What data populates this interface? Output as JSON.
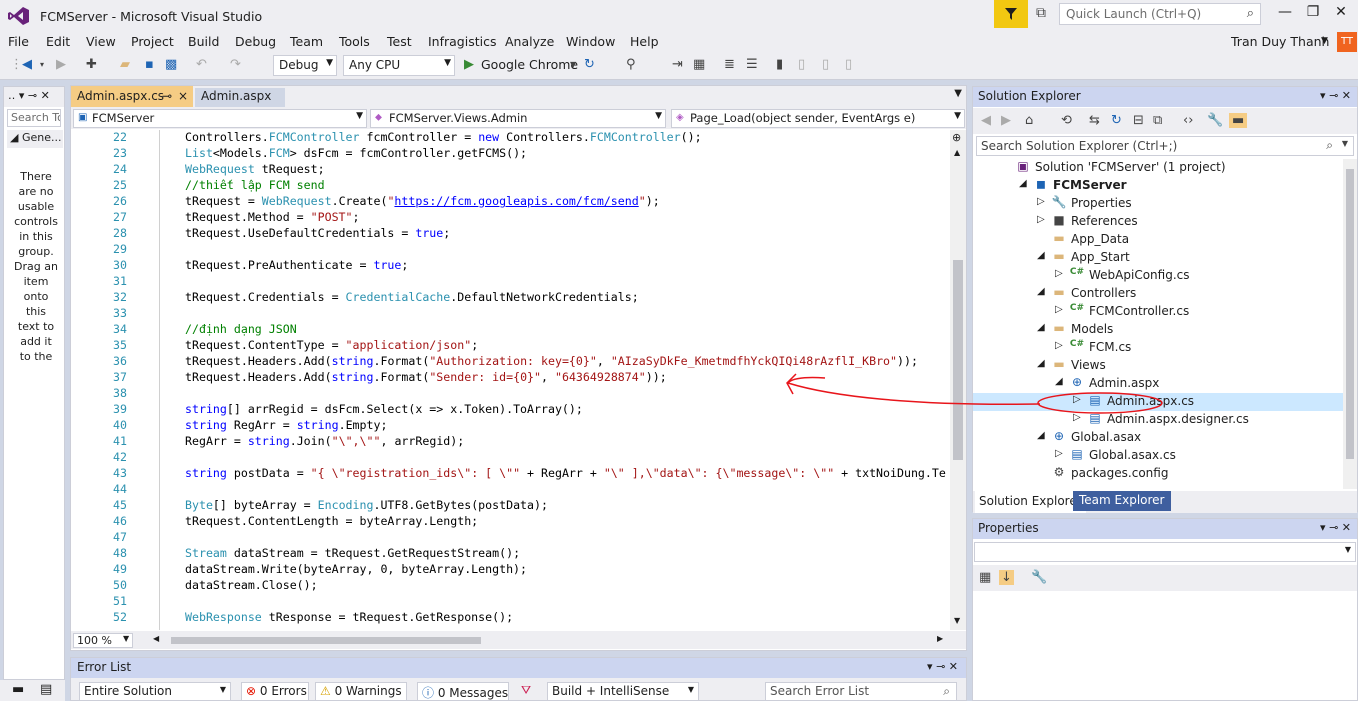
{
  "window": {
    "title": "FCMServer - Microsoft Visual Studio",
    "quick_launch": "Quick Launch (Ctrl+Q)",
    "user": "Tran Duy Thanh",
    "initials": "TT"
  },
  "menu": [
    "File",
    "Edit",
    "View",
    "Project",
    "Build",
    "Debug",
    "Team",
    "Tools",
    "Test",
    "Infragistics",
    "Analyze",
    "Window",
    "Help"
  ],
  "toolbar": {
    "config": "Debug",
    "platform": "Any CPU",
    "browser": "Google Chrome"
  },
  "toolbox": {
    "search": "Search Too",
    "group": "Gene...",
    "message": "There are no usable controls in this group. Drag an item onto this text to add it to the"
  },
  "editor": {
    "tabs": [
      {
        "label": "Admin.aspx.cs",
        "pin": "⊸",
        "close": "×"
      },
      {
        "label": "Admin.aspx"
      }
    ],
    "nav": {
      "project": "FCMServer",
      "class": "FCMServer.Views.Admin",
      "member": "Page_Load(object sender, EventArgs e)"
    },
    "zoom": "100 %",
    "lines": [
      {
        "n": "22",
        "html": "Controllers.<span class=\"t\">FCMController</span> fcmController = <span class=\"k\">new</span> Controllers.<span class=\"t\">FCMController</span>();"
      },
      {
        "n": "23",
        "html": "<span class=\"t\">List</span>&lt;Models.<span class=\"t\">FCM</span>&gt; dsFcm = fcmController.getFCMS();"
      },
      {
        "n": "24",
        "html": "<span class=\"t\">WebRequest</span> tRequest;"
      },
      {
        "n": "25",
        "html": "<span class=\"c\">//thiết lập FCM send</span>"
      },
      {
        "n": "26",
        "html": "tRequest = <span class=\"t\">WebRequest</span>.Create(<span class=\"s\">\"</span><span class=\"u\">https://fcm.googleapis.com/fcm/send</span><span class=\"s\">\"</span>);"
      },
      {
        "n": "27",
        "html": "tRequest.Method = <span class=\"s\">\"POST\"</span>;"
      },
      {
        "n": "28",
        "html": "tRequest.UseDefaultCredentials = <span class=\"k\">true</span>;"
      },
      {
        "n": "29",
        "html": ""
      },
      {
        "n": "30",
        "html": "tRequest.PreAuthenticate = <span class=\"k\">true</span>;"
      },
      {
        "n": "31",
        "html": ""
      },
      {
        "n": "32",
        "html": "tRequest.Credentials = <span class=\"t\">CredentialCache</span>.DefaultNetworkCredentials;"
      },
      {
        "n": "33",
        "html": ""
      },
      {
        "n": "34",
        "html": "<span class=\"c\">//định dạng JSON</span>"
      },
      {
        "n": "35",
        "html": "tRequest.ContentType = <span class=\"s\">\"application/json\"</span>;"
      },
      {
        "n": "36",
        "html": "tRequest.Headers.Add(<span class=\"k\">string</span>.Format(<span class=\"s\">\"Authorization: key={0}\"</span>, <span class=\"s\">\"AIzaSyDkFe_KmetmdfhYckQIQi48rAzflI_KBro\"</span>));"
      },
      {
        "n": "37",
        "html": "tRequest.Headers.Add(<span class=\"k\">string</span>.Format(<span class=\"s\">\"Sender: id={0}\"</span>, <span class=\"s\">\"64364928874\"</span>));"
      },
      {
        "n": "38",
        "html": ""
      },
      {
        "n": "39",
        "html": "<span class=\"k\">string</span>[] arrRegid = dsFcm.Select(x =&gt; x.Token).ToArray();"
      },
      {
        "n": "40",
        "html": "<span class=\"k\">string</span> RegArr = <span class=\"k\">string</span>.Empty;"
      },
      {
        "n": "41",
        "html": "RegArr = <span class=\"k\">string</span>.Join(<span class=\"s\">\"\\\",\\\"\"</span>, arrRegid);"
      },
      {
        "n": "42",
        "html": ""
      },
      {
        "n": "43",
        "html": "<span class=\"k\">string</span> postData = <span class=\"s\">\"{ \\\"registration_ids\\\": [ \\\"\"</span> + RegArr + <span class=\"s\">\"\\\" ],\\\"data\\\": {\\\"message\\\": \\\"\"</span> + txtNoiDung.Te"
      },
      {
        "n": "44",
        "html": ""
      },
      {
        "n": "45",
        "html": "<span class=\"t\">Byte</span>[] byteArray = <span class=\"t\">Encoding</span>.UTF8.GetBytes(postData);"
      },
      {
        "n": "46",
        "html": "tRequest.ContentLength = byteArray.Length;"
      },
      {
        "n": "47",
        "html": ""
      },
      {
        "n": "48",
        "html": "<span class=\"t\">Stream</span> dataStream = tRequest.GetRequestStream();"
      },
      {
        "n": "49",
        "html": "dataStream.Write(byteArray, 0, byteArray.Length);"
      },
      {
        "n": "50",
        "html": "dataStream.Close();"
      },
      {
        "n": "51",
        "html": ""
      },
      {
        "n": "52",
        "html": "<span class=\"t\">WebResponse</span> tResponse = tRequest.GetResponse();"
      }
    ]
  },
  "error_list": {
    "title": "Error List",
    "scope": "Entire Solution",
    "errors": "0 Errors",
    "warnings": "0 Warnings",
    "messages": "0 Messages",
    "build": "Build + IntelliSense",
    "search": "Search Error List"
  },
  "solution_explorer": {
    "title": "Solution Explorer",
    "search": "Search Solution Explorer (Ctrl+;)",
    "nodes": [
      {
        "label": "Solution 'FCMServer' (1 project)",
        "level": 0,
        "exp": "",
        "icon": "▣",
        "color": "#68217a"
      },
      {
        "label": "FCMServer",
        "level": 1,
        "exp": "◢",
        "icon": "◼",
        "color": "#1e64b4",
        "bold": true
      },
      {
        "label": "Properties",
        "level": 2,
        "exp": "▷",
        "icon": "🔧",
        "color": "#444"
      },
      {
        "label": "References",
        "level": 2,
        "exp": "▷",
        "icon": "■",
        "color": "#444"
      },
      {
        "label": "App_Data",
        "level": 2,
        "exp": "",
        "icon": "▬",
        "color": "#dcb67a"
      },
      {
        "label": "App_Start",
        "level": 2,
        "exp": "◢",
        "icon": "▬",
        "color": "#dcb67a"
      },
      {
        "label": "WebApiConfig.cs",
        "level": 3,
        "exp": "▷",
        "icon": "C#",
        "color": "#388a34"
      },
      {
        "label": "Controllers",
        "level": 2,
        "exp": "◢",
        "icon": "▬",
        "color": "#dcb67a"
      },
      {
        "label": "FCMController.cs",
        "level": 3,
        "exp": "▷",
        "icon": "C#",
        "color": "#388a34"
      },
      {
        "label": "Models",
        "level": 2,
        "exp": "◢",
        "icon": "▬",
        "color": "#dcb67a"
      },
      {
        "label": "FCM.cs",
        "level": 3,
        "exp": "▷",
        "icon": "C#",
        "color": "#388a34"
      },
      {
        "label": "Views",
        "level": 2,
        "exp": "◢",
        "icon": "▬",
        "color": "#dcb67a"
      },
      {
        "label": "Admin.aspx",
        "level": 3,
        "exp": "◢",
        "icon": "⊕",
        "color": "#1e64b4"
      },
      {
        "label": "Admin.aspx.cs",
        "level": 4,
        "exp": "▷",
        "icon": "▤",
        "color": "#1e64b4",
        "selected": true
      },
      {
        "label": "Admin.aspx.designer.cs",
        "level": 4,
        "exp": "▷",
        "icon": "▤",
        "color": "#1e64b4"
      },
      {
        "label": "Global.asax",
        "level": 2,
        "exp": "◢",
        "icon": "⊕",
        "color": "#1e64b4"
      },
      {
        "label": "Global.asax.cs",
        "level": 3,
        "exp": "▷",
        "icon": "▤",
        "color": "#1e64b4"
      },
      {
        "label": "packages.config",
        "level": 2,
        "exp": "",
        "icon": "⚙",
        "color": "#444"
      }
    ],
    "tabs": [
      "Solution Explorer",
      "Team Explorer"
    ]
  },
  "properties": {
    "title": "Properties"
  },
  "colors": {
    "accent": "#68217a",
    "annotation": "#e8151b",
    "tab_active": "#f5cc84"
  }
}
